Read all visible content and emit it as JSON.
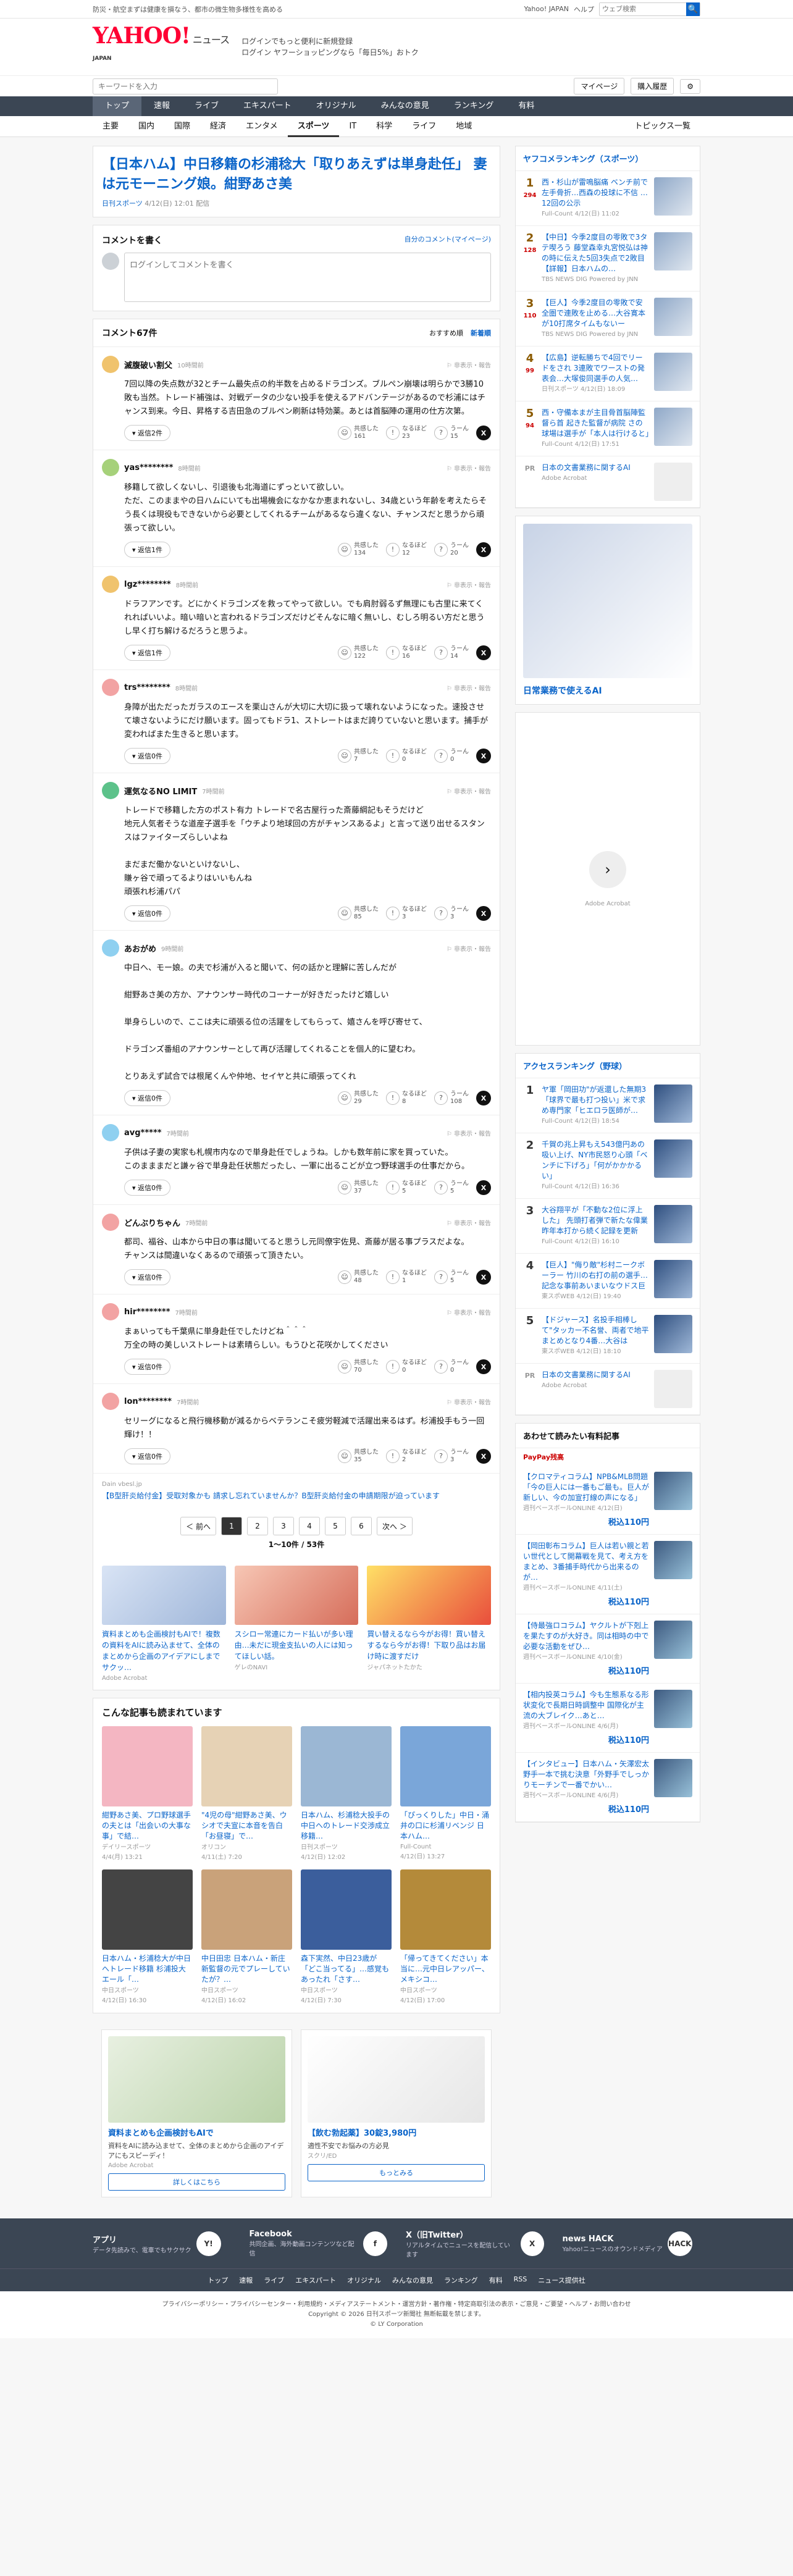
{
  "top": {
    "notice": "防災・航空まずは健康を損なう、都市の微生物多様性を高める",
    "yahoo": "Yahoo! JAPAN",
    "help": "ヘルプ",
    "search_placeholder": "ウェブ検索",
    "search_btn": "🔍"
  },
  "header": {
    "logo": "YAHOO!",
    "logo_sub": "JAPAN",
    "service": "ニュース",
    "promo1": "ログインでもっと便利に新規登録",
    "promo2": "ログイン ヤフーショッピングなら「毎日5%」おトク"
  },
  "subnav": {
    "search_placeholder": "キーワードを入力",
    "mypage": "マイページ",
    "purchased": "購入履歴"
  },
  "cats": [
    "トップ",
    "速報",
    "ライブ",
    "エキスパート",
    "オリジナル",
    "みんなの意見",
    "ランキング",
    "有料"
  ],
  "sports": [
    "主要",
    "国内",
    "国際",
    "経済",
    "エンタメ",
    "スポーツ",
    "IT",
    "科学",
    "ライフ",
    "地域"
  ],
  "topics": "トピックス一覧",
  "article": {
    "title": "【日本ハム】中日移籍の杉浦稔大「取りあえずは単身赴任」 妻は元モーニング娘。紺野あさ美",
    "source": "日刊スポーツ",
    "date": "4/12(日) 12:01 配信"
  },
  "cwrite": {
    "title": "コメントを書く",
    "mine": "自分のコメント(マイページ)",
    "placeholder": "ログインしてコメントを書く"
  },
  "chead": {
    "title": "コメント67件",
    "sort1": "おすすめ順",
    "sort2": "新着順"
  },
  "comments": [
    {
      "name": "滅腹破い割父",
      "time": "10時間前",
      "text": "7回以降の失点数が32とチーム最失点の約半数を占めるドラゴンズ。ブルペン崩壊は明らかで3勝10敗も当然。トレード補強は、対戦データの少ない投手を使えるアドバンテージがあるので杉浦にはチャンス到来。今日、昇格する吉田急のブルペン刷新は特効薬。あとは首脳陣の運用の仕方次第。",
      "r": "返信2件",
      "a": "161",
      "b": "23",
      "c": "15",
      "col": "#f0c36d"
    },
    {
      "name": "yas********",
      "time": "8時間前",
      "text": "移籍して欲しくないし、引退後も北海道にずっといて欲しい。\nただ、このままやの日ハムにいても出場機会になかなか恵まれないし、34歳という年齢を考えたらそう長くは現役もできないから必要としてくれるチームがあるなら違くない、チャンスだと思うから頑張って欲しい。",
      "r": "返信1件",
      "a": "134",
      "b": "12",
      "c": "20",
      "col": "#a6d17a"
    },
    {
      "name": "lgz********",
      "time": "8時間前",
      "text": "ドラフアンです。どにかくドラゴンズを救ってやって欲しい。でも肩肘弱るず無理にも古里に来てくれればいいよ。暗い暗いと言われるドラゴンズだけどそんなに暗く無いし、むしろ明るい方だと思うし早く打ち解けるだろうと思うよ。",
      "r": "返信1件",
      "a": "122",
      "b": "16",
      "c": "14",
      "col": "#f0c36d"
    },
    {
      "name": "trs********",
      "time": "8時間前",
      "text": "身障が出ただったガラスのエースを栗山さんが大切に大切に扱って壊れないようになった。速投させて壊さないようにだけ願います。固ってもドラ1、ストレートはまだ誇りていないと思います。捕手が変わればまた生きると思います。",
      "r": "返信0件",
      "a": "7",
      "b": "0",
      "c": "0",
      "col": "#f2a3a3"
    },
    {
      "name": "運気なるNO LIMIT",
      "time": "7時間前",
      "text": "トレードで移籍した方のポスト有力 トレードで名古屋行った斎藤綱記もそうだけど\n地元人気者そうな道産子選手を「ウチより地球回の方がチャンスあるよ」と言って送り出せるスタンスはファイターズらしいよね\n\nまだまだ働かないといけないし、\n賺ヶ谷で頑ってるよりはいいもんね\n頑張れ杉浦パパ",
      "r": "返信0件",
      "a": "85",
      "b": "3",
      "c": "3",
      "col": "#5cc28a"
    },
    {
      "name": "あおがめ",
      "time": "9時間前",
      "text": "中日へ、モー娘。の夫で杉浦が入ると聞いて、何の話かと理解に苦しんだが\n\n紺野あさ美の方か、アナウンサー時代のコーナーが好きだったけど嬉しい\n\n単身らしいので、ここは夫に頑張る位の活躍をしてもらって、嬉さんを呼び寄せて、\n\nドラゴンズ番組のアナウンサーとして再び活躍してくれることを個人的に望むわ。\n\nとりあえず試合では根尾くんや仲地、セイヤと共に頑張ってくれ",
      "r": "返信0件",
      "a": "29",
      "b": "8",
      "c": "108",
      "col": "#8fd0f0"
    },
    {
      "name": "avg*****",
      "time": "7時間前",
      "text": "子供は子妻の実家も札幌市内なので単身赴任でしょうね。しかも数年前に家を買っていた。\nこのまままだと謙ヶ谷で単身赴任状態だったし、一軍に出るこどが立つ野球選手の仕事だから。",
      "r": "返信0件",
      "a": "37",
      "b": "5",
      "c": "5",
      "col": "#8fd0f0"
    },
    {
      "name": "どんぶりちゃん",
      "time": "7時間前",
      "text": "都司、福谷、山本から中日の事は聞いてると思うし元同僚宇佐見、斎藤が居る事プラスだよな。\nチャンスは間違いなくあるので頑張って頂きたい。",
      "r": "返信0件",
      "a": "48",
      "b": "1",
      "c": "5",
      "col": "#f2a3a3"
    },
    {
      "name": "hir********",
      "time": "7時間前",
      "text": "まぁいっても千葉県に単身赴任でしたけどね＾＾＾\n万全の時の美しいストレートは素晴らしい。もうひと花咲かしてください",
      "r": "返信0件",
      "a": "70",
      "b": "0",
      "c": "0",
      "col": "#f2a3a3"
    },
    {
      "name": "lon********",
      "time": "7時間前",
      "text": "セリーグになると飛行機移動が減るからベテランこそ疲労軽減で活躍出来るはず。杉浦投手もう一回輝け！！",
      "r": "返信0件",
      "a": "35",
      "b": "2",
      "c": "3",
      "col": "#f2a3a3"
    }
  ],
  "inline_ad": {
    "sponsor": "Dain vbesl.jp",
    "text": "【B型肝炎給付金】受取対象かも 請求し忘れていませんか？B型肝炎給付金の申請期限が迫っています"
  },
  "pager": {
    "prev": "＜ 前へ",
    "pages": [
      "1",
      "2",
      "3",
      "4",
      "5",
      "6"
    ],
    "next": "次へ ＞",
    "count": "1〜10件 / 53件"
  },
  "ads3": [
    {
      "t": "資料まとめも企画検討もAIで！複数の資料をAIに読み込ませて、全体のまとめから企画のアイデアにしまでサクッ…",
      "s": "Adobe Acrobat"
    },
    {
      "t": "スシロー常連にカード払いが多い理由…未だに現金支払いの人には知ってほしい話。",
      "s": "ゲレのNAVI"
    },
    {
      "t": "買い替えるなら今がお得！買い替えするなら今がお得！下取り品はお届け時に渡すだけ",
      "s": "ジャパネットたかた"
    }
  ],
  "recommend_title": "こんな記事も読まれています",
  "recs": [
    {
      "t": "紺野あさ美、プロ野球選手の夫とは「出会いの大事な事」で結…",
      "s": "デイリースポーツ",
      "d": "4/4(月) 13:21"
    },
    {
      "t": "\"4児の母\"紺野あさ美、ウシオで夫宣に本音を告白 「お昼寝」で…",
      "s": "オリコン",
      "d": "4/11(土) 7:20"
    },
    {
      "t": "日本ハム、杉浦稔大投手の中日へのトレード交渉成立 移籍…",
      "s": "日刊スポーツ",
      "d": "4/12(日) 12:02"
    },
    {
      "t": "「ぴっくりした」中日・涌井の口に杉浦リベンジ 日本ハム…",
      "s": "Full-Count",
      "d": "4/12(日) 13:27"
    },
    {
      "t": "日本ハム・杉浦稔大が中日へトレード移籍 杉浦投大エール「…",
      "s": "中日スポーツ",
      "d": "4/12(日) 16:30"
    },
    {
      "t": "中日田忠 日本ハム・新庄新監督の元でプレーしていたが？…",
      "s": "中日スポーツ",
      "d": "4/12(日) 16:02"
    },
    {
      "t": "森下実然、中日23歳が「どこ当ってる」…感覚もあったれ「さす…",
      "s": "中日スポーツ",
      "d": "4/12(日) 7:30"
    },
    {
      "t": "「帰ってきてください」本当に…元中日レアッパー、メキシコ…",
      "s": "中日スポーツ",
      "d": "4/12(日) 17:00"
    }
  ],
  "bottom_ads": [
    {
      "t": "資料まとめも企画検討もAIで",
      "d": "資料をAIに読み込ませて、全体のまとめから企画のアイデアにもスピーディ！",
      "s": "Adobe Acrobat",
      "b": "詳しくはこちら"
    },
    {
      "t": "【飲む勃起薬】30錠3,980円",
      "d": "適性不安でお悩みの方必見",
      "s": "スクリ/ED",
      "b": "もっとみる"
    }
  ],
  "side": {
    "rank_title": "ヤフコメランキング（スポーツ）",
    "ranks": [
      {
        "n": "1",
        "c": "294",
        "t": "西・杉山が雷鳴脳痛 ベンチ前で左手骨折…西森の投球に不信 …12回の公示",
        "s": "Full-Count 4/12(日) 11:02"
      },
      {
        "n": "2",
        "c": "128",
        "t": "【中日】今季2度目の零敗で3タテ喫ろう 藤堂森幸丸宮悦弘は神の時に伝えた5回3失点で2敗目【詳報】日本ハムの…",
        "s": "TBS NEWS DIG Powered by JNN"
      },
      {
        "n": "3",
        "c": "110",
        "t": "【巨人】今季2度目の零敗で安全圏で連敗を止める…大谷寛本が10打席タイムもないー",
        "s": "TBS NEWS DIG Powered by JNN"
      },
      {
        "n": "4",
        "c": "99",
        "t": "【広島】逆転勝ちで4回でリードをされ 3連敗でワーストの発表会…大塚俊同選手の人気…",
        "s": "日刊スポーツ 4/12(日) 18:09"
      },
      {
        "n": "5",
        "c": "94",
        "t": "西・守備本まが主目骨首脳陣監督ら首 起きた監督が病院 さの球場は選手が「本人は行けると」",
        "s": "Full-Count 4/12(日) 17:51"
      }
    ],
    "pr1": "日本の文書業務に関するAI",
    "pr1s": "Adobe Acrobat",
    "ad_title": "日常業務で使えるAI",
    "ad2s": "Adobe Acrobat",
    "access_title": "アクセスランキング（野球）",
    "access": [
      {
        "n": "1",
        "t": "ヤ軍「岡田功\"が返還した無期3「球界で最も打つ投い」米で求め専門家「ヒエロラ医師が…",
        "s": "Full-Count 4/12(日) 18:54"
      },
      {
        "n": "2",
        "t": "千賀の兆上昇もえ543億円あの吸い上げ、NY市民怒り心頭「ベンチに下げろ」「何がかかかるい」",
        "s": "Full-Count 4/12(日) 16:36"
      },
      {
        "n": "3",
        "t": "大谷翔平が「不動な2位に浮上した」 先頭打者弾で新たな偉業 昨年本打から続く記録を更新",
        "s": "Full-Count 4/12(日) 16:10"
      },
      {
        "n": "4",
        "t": "【巨人】\"侮り敵\"杉村ニークボーラー 竹川の右打の前の選手…記念な事前あいまいなウドス巨",
        "s": "東スポWEB 4/12(日) 19:40"
      },
      {
        "n": "5",
        "t": "【ドジャース】名投手相棒して\"タッカー不名誉、両者で地平まとめとなり4番…大谷は",
        "s": "東スポWEB 4/12(日) 18:10"
      }
    ],
    "pr2": "日本の文書業務に関するAI",
    "pr2s": "Adobe Acrobat",
    "shop_title": "あわせて読みたい有料記事",
    "shop_badge": "PayPay残高",
    "shops": [
      {
        "t": "【クロマティコラム】NPB&MLB問題「今の巨人には一番もご最も。巨人が新しい、今の加宣打線の声になる」",
        "s": "週刊ベースボールONLINE 4/12(日)",
        "p": "税込110円"
      },
      {
        "t": "【岡田彰布コラム】巨人は若い親と若い世代として開幕戦を見て、考え方をまとめ、3番捕手時代から出来るのが…",
        "s": "週刊ベースボールONLINE 4/11(土)",
        "p": "税込110円"
      },
      {
        "t": "【侍最強ロコラム】ヤクルトが下剋上を果たすのが大好き。同は相時の中で必要な活動をぜひ…",
        "s": "週刊ベースボールONLINE 4/10(金)",
        "p": "税込110円"
      },
      {
        "t": "【相内投英コラム】今も生態系なる形状変化で長期日時調整中 国際化が主流の大ブレイク…あと…",
        "s": "週刊ベースボールONLINE 4/6(月)",
        "p": "税込110円"
      },
      {
        "t": "【インタビュー】日本ハム・矢澤宏太野手一本で挑む決意「外野手でしっかりモーチンで一番でかい…",
        "s": "週刊ベースボールONLINE 4/6(月)",
        "p": "税込110円"
      }
    ]
  },
  "footer": {
    "apps": [
      {
        "t": "アプリ",
        "d": "データ先読みで、電車でもサクサク",
        "i": "Y!"
      },
      {
        "t": "Facebook",
        "d": "共同企画、海外動画コンテンツなど配信",
        "i": "f"
      },
      {
        "t": "X（旧Twitter）",
        "d": "リアルタイムでニュースを配信しています",
        "i": "X"
      },
      {
        "t": "news HACK",
        "d": "Yahoo!ニュースのオウンドメディア",
        "i": "HACK"
      }
    ],
    "links": [
      "トップ",
      "速報",
      "ライブ",
      "エキスパート",
      "オリジナル",
      "みんなの意見",
      "ランキング",
      "有料",
      "RSS",
      "ニュース提供社"
    ],
    "policy": "プライバシーポリシー・プライバシーセンター・利用規約・メディアステートメント・運営方針・著作権・特定商取引法の表示・ご意見・ご要望・ヘルプ・お問い合わせ",
    "copy1": "Copyright © 2026 日刊スポーツ新聞社 無断転載を禁じます。",
    "copy2": "© LY Corporation"
  }
}
